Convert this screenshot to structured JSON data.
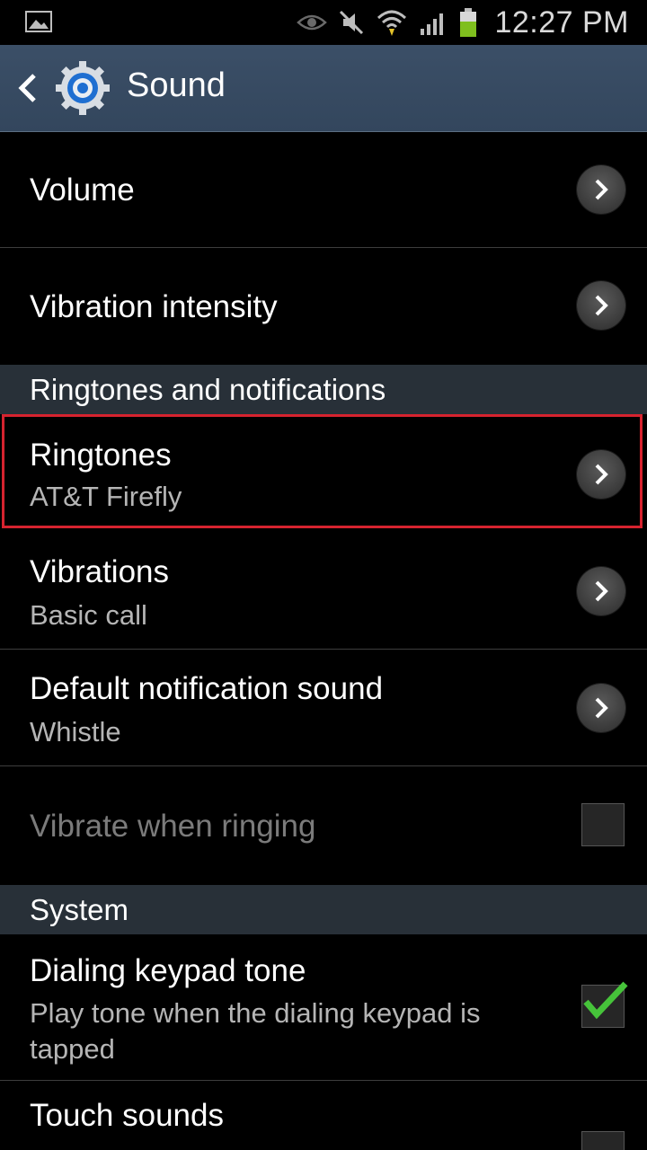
{
  "status_bar": {
    "time": "12:27 PM",
    "icons": [
      "gallery-icon",
      "eye-icon",
      "mute-icon",
      "wifi-icon",
      "signal-icon",
      "battery-icon"
    ]
  },
  "action_bar": {
    "title": "Sound",
    "back_icon": "chevron-left-icon",
    "app_icon": "settings-gear-icon"
  },
  "items": {
    "volume": {
      "label": "Volume"
    },
    "vibration_intensity": {
      "label": "Vibration intensity"
    },
    "ringtones": {
      "label": "Ringtones",
      "summary": "AT&T Firefly"
    },
    "vibrations": {
      "label": "Vibrations",
      "summary": "Basic call"
    },
    "default_notification_sound": {
      "label": "Default notification sound",
      "summary": "Whistle"
    },
    "vibrate_when_ringing": {
      "label": "Vibrate when ringing",
      "checked": false,
      "enabled": false
    },
    "dialing_keypad_tone": {
      "label": "Dialing keypad tone",
      "summary": "Play tone when the dialing keypad is tapped",
      "checked": true
    },
    "touch_sounds": {
      "label": "Touch sounds",
      "checked": false
    }
  },
  "sections": {
    "ringtones_notifications": "Ringtones and notifications",
    "system": "System"
  },
  "colors": {
    "accent_check": "#46c33a",
    "highlight_border": "#d6232f",
    "action_bar": "#3b4f67",
    "section_header": "#283038"
  }
}
